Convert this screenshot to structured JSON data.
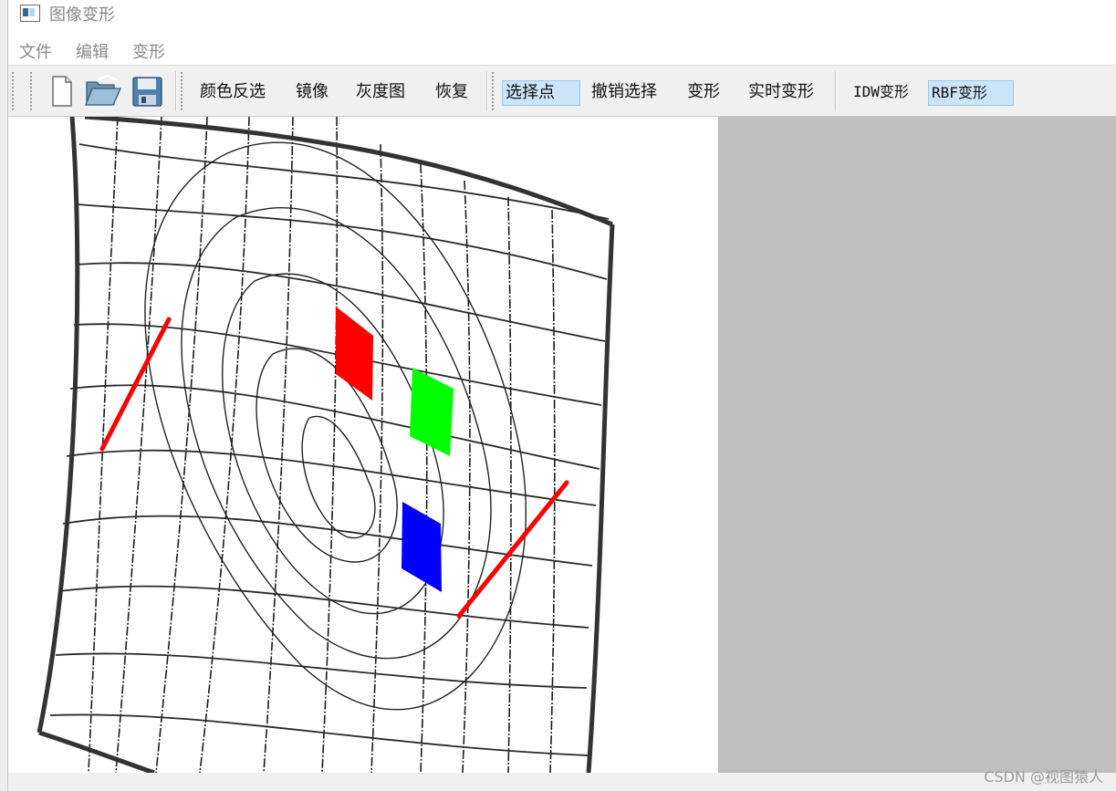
{
  "window": {
    "title": "图像变形"
  },
  "menu": {
    "file": "文件",
    "edit": "编辑",
    "warp": "变形"
  },
  "toolbar": {
    "new_icon": "new-file-icon",
    "open_icon": "open-folder-icon",
    "save_icon": "save-disk-icon",
    "invert": "颜色反选",
    "mirror": "镜像",
    "grayscale": "灰度图",
    "restore": "恢复",
    "select_point": "选择点",
    "undo_select": "撤销选择",
    "warp": "变形",
    "realtime_warp": "实时变形",
    "idw_warp": "IDW变形",
    "rbf_warp": "RBF变形"
  },
  "toggle_states": {
    "select_point_checked": true,
    "rbf_checked": true
  },
  "image": {
    "description_colors": {
      "red": "#ff0000",
      "green": "#00ff00",
      "blue": "#0000ff",
      "control_line": "#ff0000"
    }
  },
  "watermark": "CSDN @视图猿人"
}
